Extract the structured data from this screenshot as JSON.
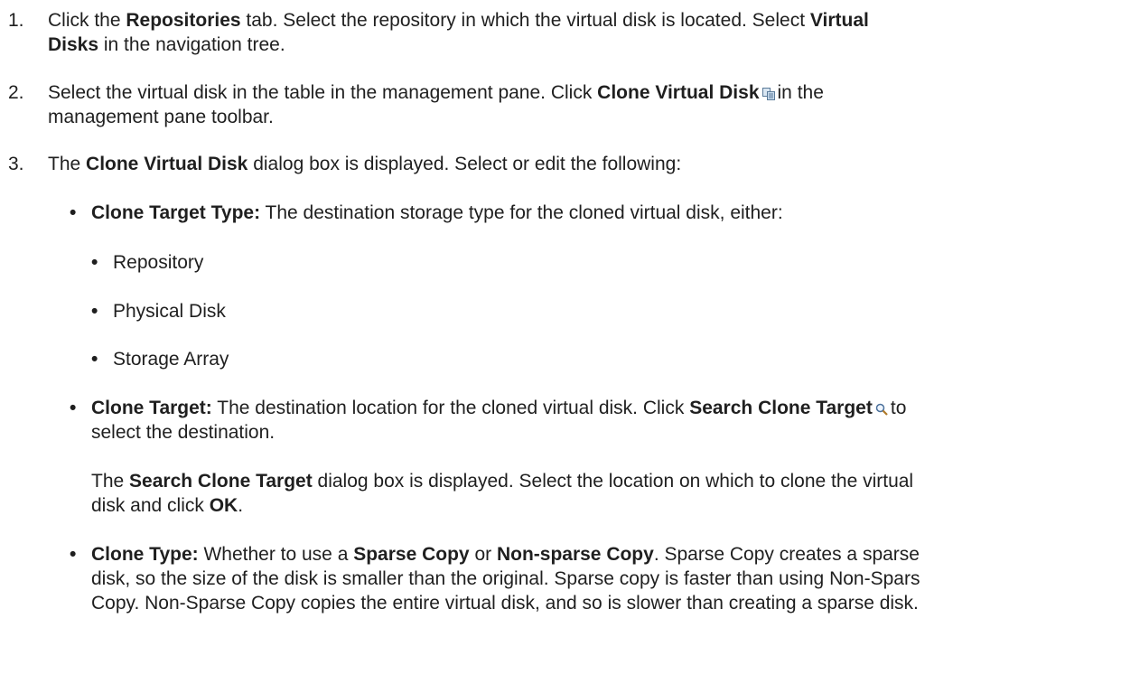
{
  "steps": [
    {
      "num": "1.",
      "l1": [
        "Click the ",
        "Repositories",
        " tab. Select the repository in which the virtual disk is located. Select ",
        "Virtual"
      ],
      "l2": [
        "Disks",
        " in the navigation tree."
      ]
    },
    {
      "num": "2.",
      "l1": [
        "Select the virtual disk in the table in the management pane. Click ",
        "Clone Virtual Disk",
        "in the"
      ],
      "l2": [
        "management pane toolbar."
      ],
      "icon": "clone-virtual-disk-icon"
    },
    {
      "num": "3.",
      "l1": [
        "The ",
        "Clone Virtual Disk",
        " dialog box is displayed. Select or edit the following:"
      ]
    }
  ],
  "clone_target_type": {
    "label": "Clone Target Type:",
    "text": " The destination storage type for the cloned virtual disk, either:",
    "options": [
      "Repository",
      "Physical Disk",
      "Storage Array"
    ]
  },
  "clone_target": {
    "label": "Clone Target:",
    "l1": " The destination location for the cloned virtual disk. Click ",
    "button": "Search Clone Target",
    "l1_end": "to",
    "l2": "select the destination.",
    "icon": "search-icon",
    "p2": {
      "a": "The ",
      "dialog": "Search Clone Target",
      "b": " dialog box is displayed. Select the location on which to clone the virtual",
      "c": "disk and click ",
      "ok": "OK",
      "d": "."
    }
  },
  "clone_type": {
    "label": "Clone Type:",
    "a": " Whether to use a ",
    "sparse": "Sparse Copy",
    "or": " or ",
    "nonsparse": "Non-sparse Copy",
    "b": ". Sparse Copy creates a sparse",
    "l2": "disk, so the size of the disk is smaller than the original. Sparse copy is faster than using Non-Spars",
    "l3": "Copy. Non-Sparse Copy copies the entire virtual disk, and so is slower than creating a sparse disk."
  }
}
